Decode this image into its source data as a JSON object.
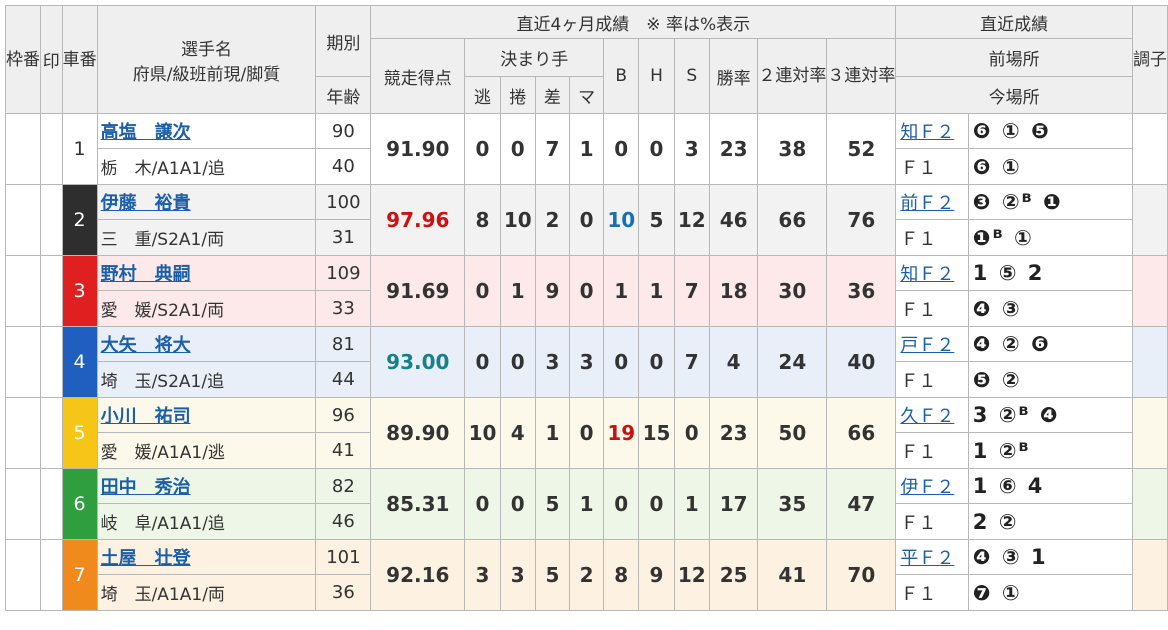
{
  "headers": {
    "waku": "枠番",
    "shirushi": "印",
    "shaban": "車番",
    "name_line1": "選手名",
    "name_line2": "府県/級班前現/脚質",
    "period": "期別",
    "age": "年齢",
    "recent4": "直近4ヶ月成績　※ 率は%表示",
    "score": "競走得点",
    "kimarite": "決まり手",
    "nige": "逃",
    "makuri": "捲",
    "sashi": "差",
    "mark": "マ",
    "b": "B",
    "h": "H",
    "s": "S",
    "win": "勝率",
    "ren2": "２連対率",
    "ren3": "３連対率",
    "recent_results": "直近成績",
    "prev_venue": "前場所",
    "curr_venue": "今場所",
    "condition": "調子"
  },
  "rows": [
    {
      "waku": "",
      "shaban": "1",
      "name": "高塩　譲次",
      "pref": "栃　木/A1A1/追",
      "period": "90",
      "age": "40",
      "score": "91.90",
      "nige": "0",
      "makuri": "0",
      "sashi": "7",
      "mark": "1",
      "b": "0",
      "h": "0",
      "s": "3",
      "win": "23",
      "ren2": "38",
      "ren3": "52",
      "prev_label": "知Ｆ２",
      "prev_results": "❻ ① ❺",
      "curr_label": "Ｆ１",
      "curr_results": "❻ ①"
    },
    {
      "waku": "2",
      "shaban": "2",
      "name": "伊藤　裕貴",
      "pref": "三　重/S2A1/両",
      "period": "100",
      "age": "31",
      "score": "97.96",
      "nige": "8",
      "makuri": "10",
      "sashi": "2",
      "mark": "0",
      "b": "10",
      "h": "5",
      "s": "12",
      "win": "46",
      "ren2": "66",
      "ren3": "76",
      "prev_label": "前Ｆ２",
      "prev_results": "❸ ②ᴮ ❶",
      "curr_label": "Ｆ１",
      "curr_results": "❶ᴮ ①"
    },
    {
      "waku": "3",
      "shaban": "3",
      "name": "野村　典嗣",
      "pref": "愛　媛/S2A1/両",
      "period": "109",
      "age": "33",
      "score": "91.69",
      "nige": "0",
      "makuri": "1",
      "sashi": "9",
      "mark": "0",
      "b": "1",
      "h": "1",
      "s": "7",
      "win": "18",
      "ren2": "30",
      "ren3": "36",
      "prev_label": "知Ｆ２",
      "prev_results": "1 ⑤ 2",
      "curr_label": "Ｆ１",
      "curr_results": "❹ ③"
    },
    {
      "waku": "4",
      "shaban": "4",
      "name": "大矢　将大",
      "pref": "埼　玉/S2A1/追",
      "period": "81",
      "age": "44",
      "score": "93.00",
      "nige": "0",
      "makuri": "0",
      "sashi": "3",
      "mark": "3",
      "b": "0",
      "h": "0",
      "s": "7",
      "win": "4",
      "ren2": "24",
      "ren3": "40",
      "prev_label": "戸Ｆ２",
      "prev_results": "❹ ② ❻",
      "curr_label": "Ｆ１",
      "curr_results": "❺ ②"
    },
    {
      "waku": "5",
      "shaban": "5",
      "name": "小川　祐司",
      "pref": "愛　媛/A1A1/逃",
      "period": "96",
      "age": "41",
      "score": "89.90",
      "nige": "10",
      "makuri": "4",
      "sashi": "1",
      "mark": "0",
      "b": "19",
      "h": "15",
      "s": "0",
      "win": "23",
      "ren2": "50",
      "ren3": "66",
      "prev_label": "久Ｆ２",
      "prev_results": "3 ②ᴮ ❹",
      "curr_label": "Ｆ１",
      "curr_results": "1 ②ᴮ"
    },
    {
      "waku": "6",
      "shaban": "6",
      "name": "田中　秀治",
      "pref": "岐　阜/A1A1/追",
      "period": "82",
      "age": "46",
      "score": "85.31",
      "nige": "0",
      "makuri": "0",
      "sashi": "5",
      "mark": "1",
      "b": "0",
      "h": "0",
      "s": "1",
      "win": "17",
      "ren2": "35",
      "ren3": "47",
      "prev_label": "伊Ｆ２",
      "prev_results": "1 ⑥ 4",
      "curr_label": "Ｆ１",
      "curr_results": "2 ②"
    },
    {
      "waku": "7",
      "shaban": "7",
      "name": "土屋　壮登",
      "pref": "埼　玉/A1A1/両",
      "period": "101",
      "age": "36",
      "score": "92.16",
      "nige": "3",
      "makuri": "3",
      "sashi": "5",
      "mark": "2",
      "b": "8",
      "h": "9",
      "s": "12",
      "win": "25",
      "ren2": "41",
      "ren3": "70",
      "prev_label": "平Ｆ２",
      "prev_results": "❹ ③ 1",
      "curr_label": "Ｆ１",
      "curr_results": "❼ ①"
    }
  ],
  "colors": {
    "waku1": "#ffffff",
    "waku2": "#2e2e2e",
    "waku3": "#e02020",
    "waku4": "#1f5fbf",
    "waku5": "#f5c518",
    "waku6": "#2e9e3e",
    "waku7": "#f08a1c",
    "score_high": "#cc1111",
    "score_second": "#1a7f8a",
    "b_top": "#1a6fb0"
  }
}
